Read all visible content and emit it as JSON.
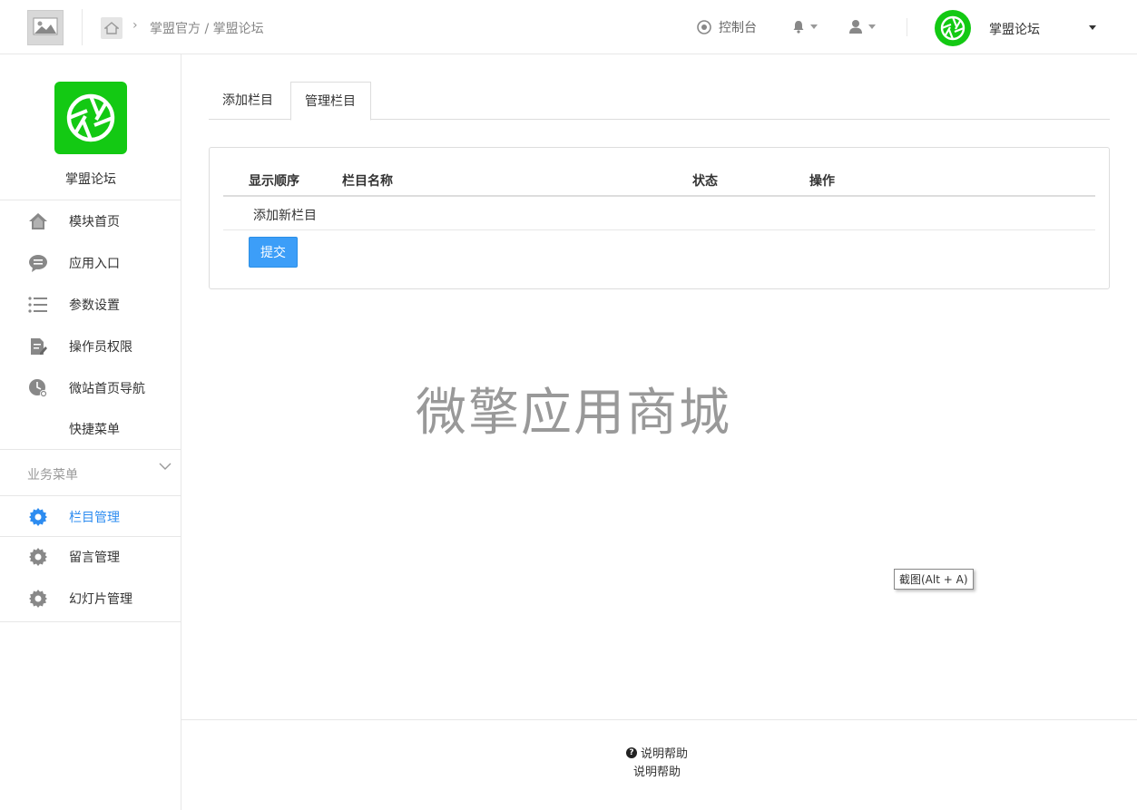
{
  "header": {
    "breadcrumb_parent": "掌盟官方",
    "breadcrumb_sep": " / ",
    "breadcrumb_current": "掌盟论坛",
    "console_label": "控制台",
    "account_name": "掌盟论坛"
  },
  "sidebar": {
    "app_name": "掌盟论坛",
    "items": [
      {
        "label": "模块首页",
        "icon": "home-icon"
      },
      {
        "label": "应用入口",
        "icon": "chat-icon"
      },
      {
        "label": "参数设置",
        "icon": "list-icon"
      },
      {
        "label": "操作员权限",
        "icon": "edit-doc-icon"
      },
      {
        "label": "微站首页导航",
        "icon": "clock-icon"
      },
      {
        "label": "快捷菜单",
        "icon": ""
      }
    ],
    "section_title": "业务菜单",
    "business_items": [
      {
        "label": "栏目管理",
        "icon": "gear-icon",
        "active": true
      },
      {
        "label": "留言管理",
        "icon": "gear-icon"
      },
      {
        "label": "幻灯片管理",
        "icon": "gear-icon"
      }
    ]
  },
  "main": {
    "tabs": [
      {
        "label": "添加栏目"
      },
      {
        "label": "管理栏目",
        "active": true
      }
    ],
    "table": {
      "headers": [
        "显示顺序",
        "栏目名称",
        "状态",
        "操作"
      ],
      "add_row": "添加新栏目"
    },
    "submit_label": "提交"
  },
  "watermark": "微擎应用商城",
  "tooltip": "截图(Alt + A)",
  "footer": {
    "help_link": "说明帮助",
    "help_text": "说明帮助"
  },
  "colors": {
    "brand_green": "#13c913",
    "accent_blue": "#2d8cf0",
    "submit_blue": "#3c9ef8"
  }
}
